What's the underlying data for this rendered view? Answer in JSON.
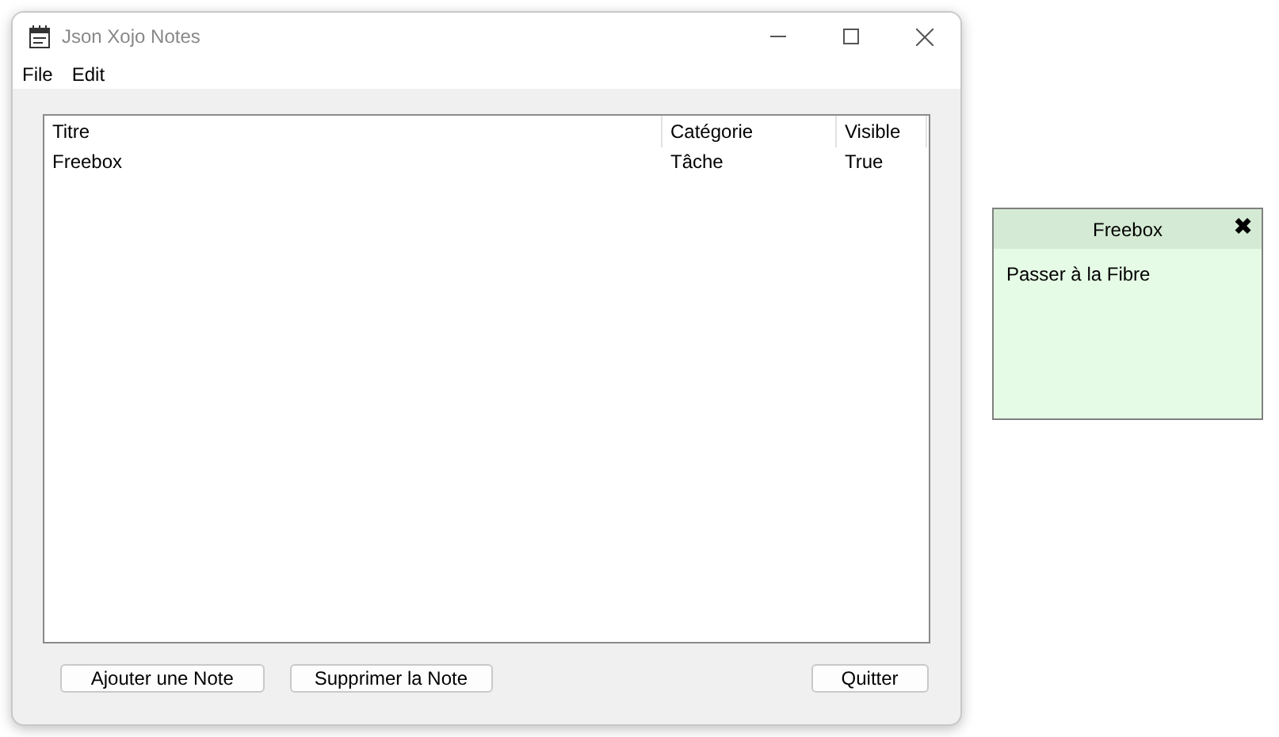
{
  "window": {
    "title": "Json Xojo Notes"
  },
  "menu": [
    "File",
    "Edit"
  ],
  "table": {
    "columns": [
      "Titre",
      "Catégorie",
      "Visible"
    ],
    "rows": [
      [
        "Freebox",
        "Tâche",
        "True"
      ]
    ]
  },
  "buttons": [
    "Ajouter une Note",
    "Supprimer la Note",
    "Quitter"
  ],
  "note": {
    "title": "Freebox",
    "close": "✖",
    "text": "Passer à la Fibre"
  }
}
